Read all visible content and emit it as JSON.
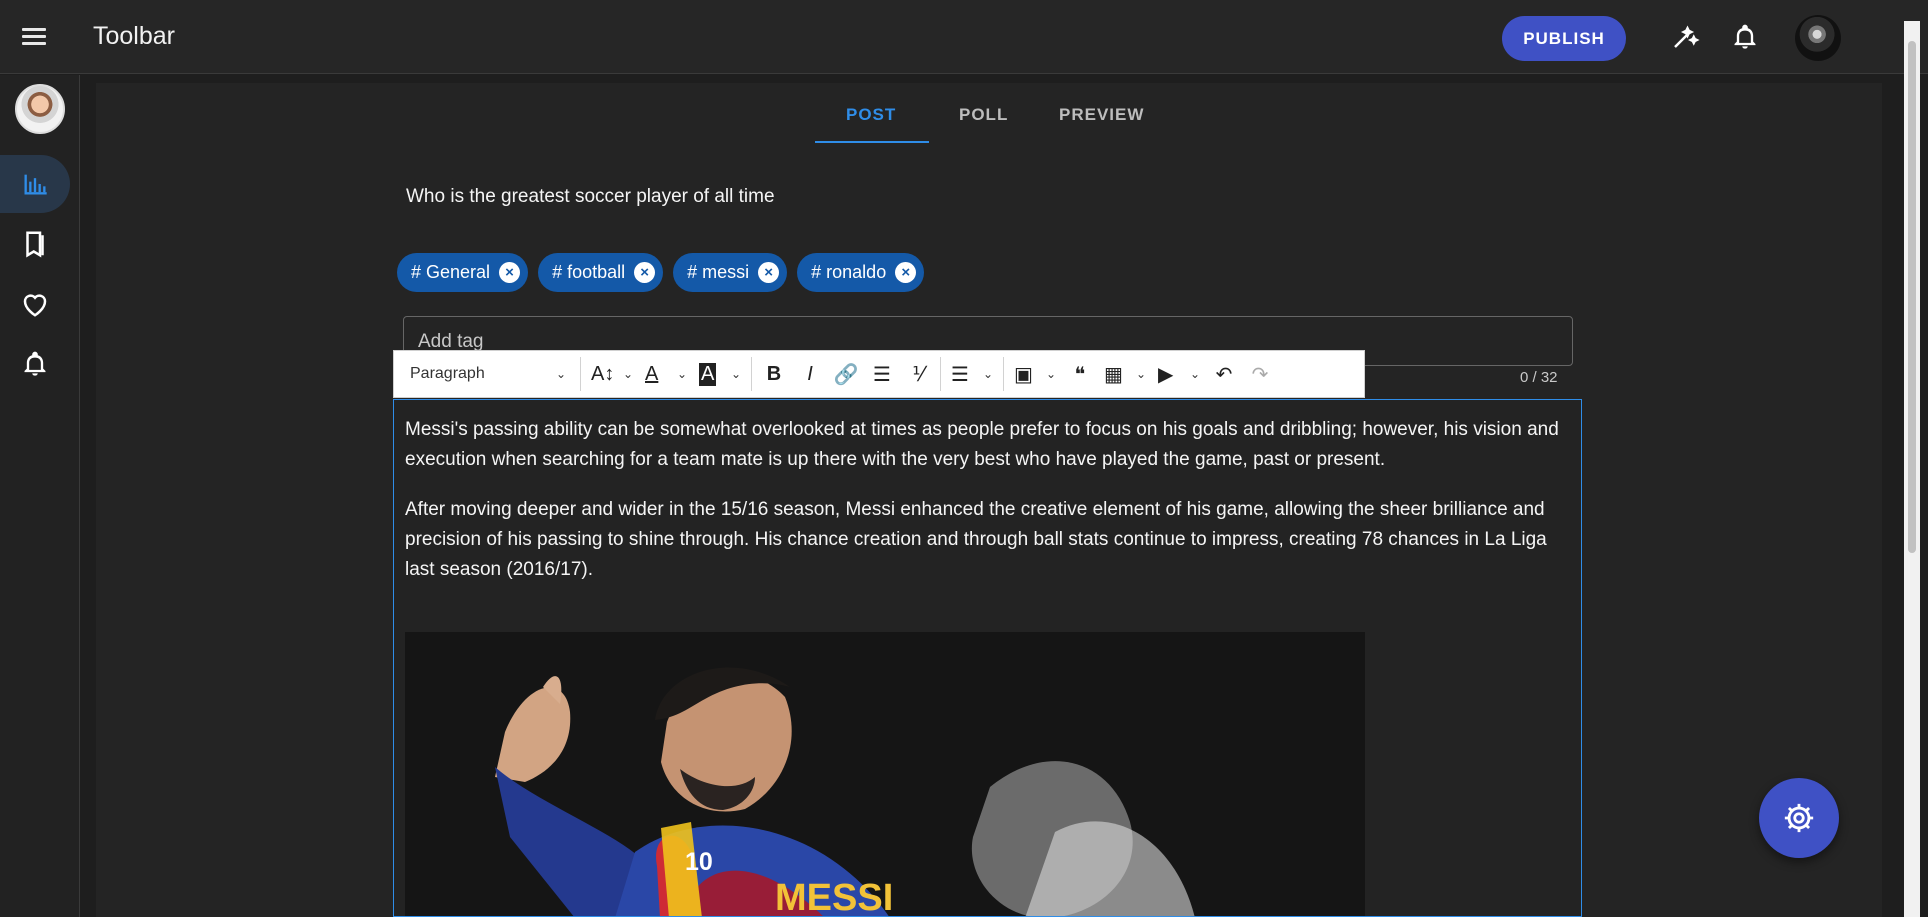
{
  "app": {
    "title": "Toolbar"
  },
  "header": {
    "publish_label": "PUBLISH",
    "icons": [
      "menu-icon",
      "magic-wand-icon",
      "bell-icon",
      "avatar"
    ]
  },
  "sidebar": {
    "items": [
      {
        "name": "dashboard-icon",
        "active": true
      },
      {
        "name": "bookmark-icon",
        "active": false
      },
      {
        "name": "heart-icon",
        "active": false
      },
      {
        "name": "notification-icon",
        "active": false
      }
    ]
  },
  "tabs": [
    {
      "label": "POST",
      "active": true
    },
    {
      "label": "POLL",
      "active": false
    },
    {
      "label": "PREVIEW",
      "active": false
    }
  ],
  "post": {
    "title": "Who is the greatest soccer player of all time",
    "tags": [
      "# General",
      "# football",
      "# messi",
      "# ronaldo"
    ],
    "tag_placeholder": "Add tag",
    "tag_counter": "0 / 32"
  },
  "toolbar": {
    "paragraph": "Paragraph",
    "tools": [
      "font-size-icon",
      "font-color-icon",
      "highlight-icon",
      "bold-icon",
      "italic-icon",
      "link-icon",
      "bulleted-list-icon",
      "numbered-list-icon",
      "align-icon",
      "image-icon",
      "quote-icon",
      "table-icon",
      "media-icon",
      "undo-icon",
      "redo-icon"
    ]
  },
  "editor": {
    "paragraph_1": "Messi's passing ability can be somewhat overlooked at times as people prefer to focus on his goals and dribbling; however, his vision and execution when searching for a team mate is up there with the very best who have played the game, past or present.",
    "paragraph_2": "After moving deeper and wider in the 15/16 season, Messi enhanced the creative element of his game, allowing the sheer brilliance and precision of his passing to shine through. His chance creation and through ball stats continue to impress, creating 78 chances in La Liga last season (2016/17).",
    "photo_number": "10",
    "photo_name": "MESSI"
  },
  "colors": {
    "accent": "#2f8de8",
    "publish": "#3f51c5",
    "chip": "#1459a8"
  }
}
